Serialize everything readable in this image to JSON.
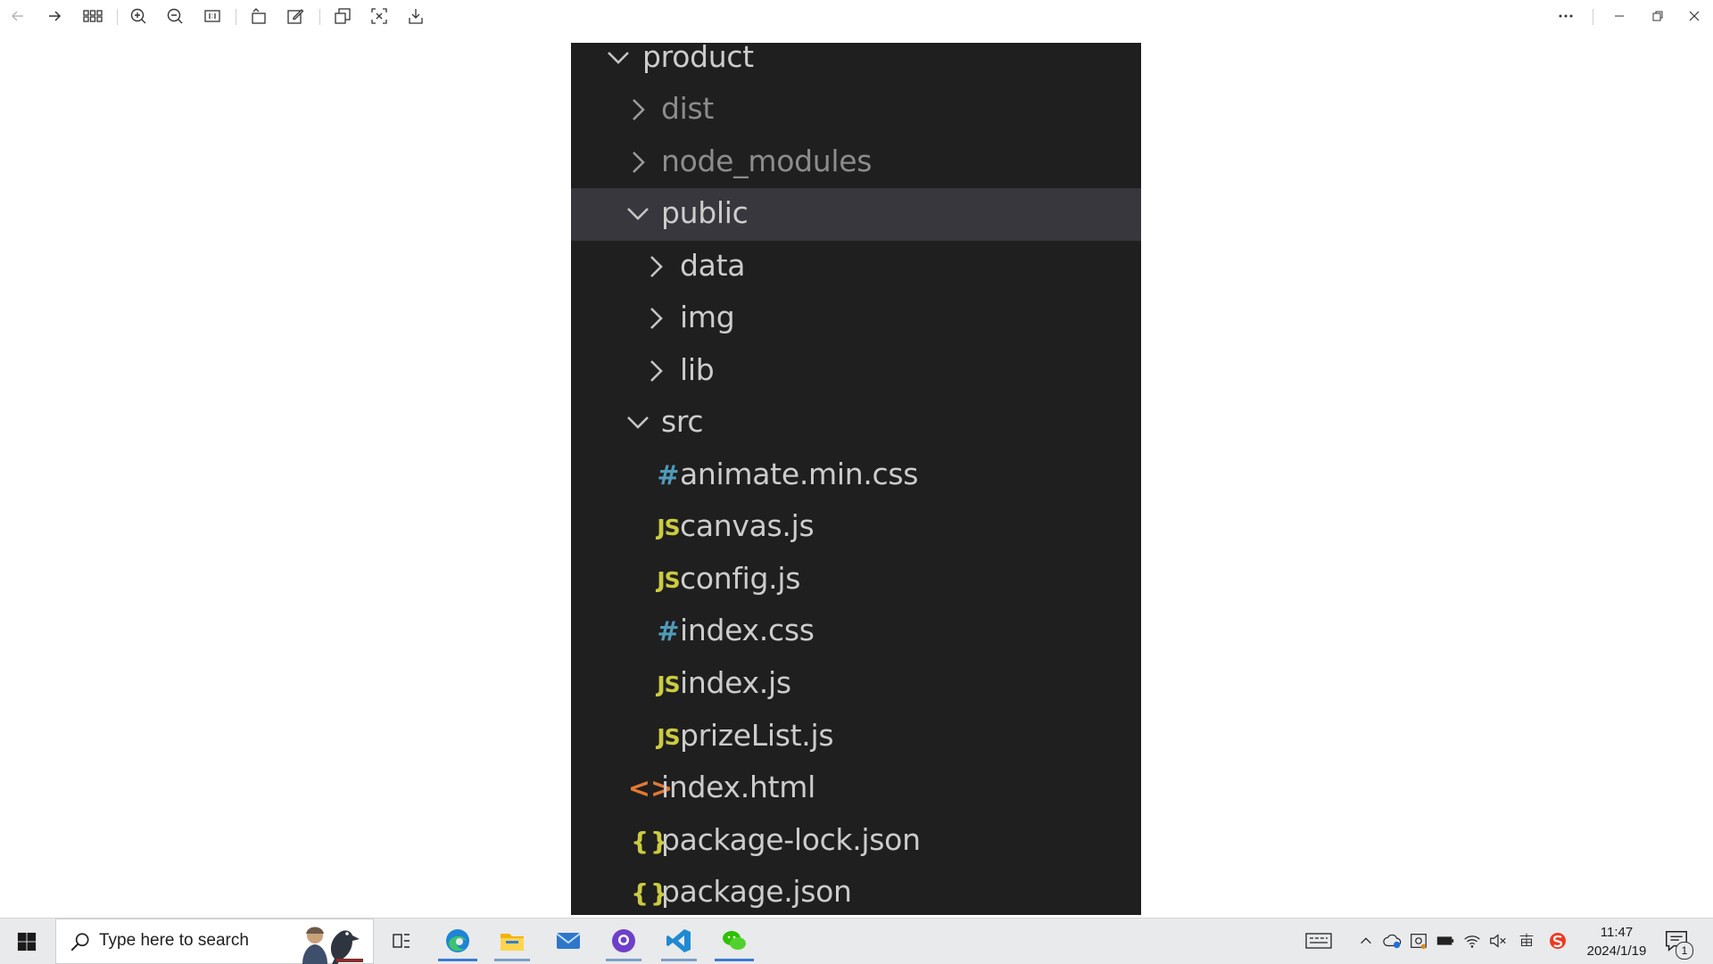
{
  "explorer": {
    "items": [
      {
        "label": "product",
        "kind": "folder",
        "expanded": true,
        "depth": 0
      },
      {
        "label": "dist",
        "kind": "folder",
        "expanded": false,
        "depth": 1,
        "dim": true
      },
      {
        "label": "node_modules",
        "kind": "folder",
        "expanded": false,
        "depth": 1,
        "dim": true
      },
      {
        "label": "public",
        "kind": "folder",
        "expanded": true,
        "depth": 1,
        "selected": true
      },
      {
        "label": "data",
        "kind": "folder",
        "expanded": false,
        "depth": 2
      },
      {
        "label": "img",
        "kind": "folder",
        "expanded": false,
        "depth": 2
      },
      {
        "label": "lib",
        "kind": "folder",
        "expanded": false,
        "depth": 2
      },
      {
        "label": "src",
        "kind": "folder",
        "expanded": true,
        "depth": 1
      },
      {
        "label": "animate.min.css",
        "kind": "css",
        "depth": 2
      },
      {
        "label": "canvas.js",
        "kind": "js",
        "depth": 2
      },
      {
        "label": "config.js",
        "kind": "js",
        "depth": 2
      },
      {
        "label": "index.css",
        "kind": "css",
        "depth": 2
      },
      {
        "label": "index.js",
        "kind": "js",
        "depth": 2
      },
      {
        "label": "prizeList.js",
        "kind": "js",
        "depth": 2
      },
      {
        "label": "index.html",
        "kind": "html",
        "depth": 1
      },
      {
        "label": "package-lock.json",
        "kind": "json",
        "depth": 1
      },
      {
        "label": "package.json",
        "kind": "json",
        "depth": 1
      }
    ],
    "icon_glyphs": {
      "js": "JS",
      "css": "#",
      "html": "<>",
      "json": "{}"
    }
  },
  "taskbar": {
    "search_placeholder": "Type here to search",
    "time": "11:47",
    "date": "2024/1/19",
    "notification_count": "1"
  },
  "colors": {
    "explorer_bg": "#1f1f1f",
    "selected_row": "#37373d",
    "js_icon": "#cbcb41",
    "css_icon": "#519aba",
    "html_icon": "#e37933"
  }
}
